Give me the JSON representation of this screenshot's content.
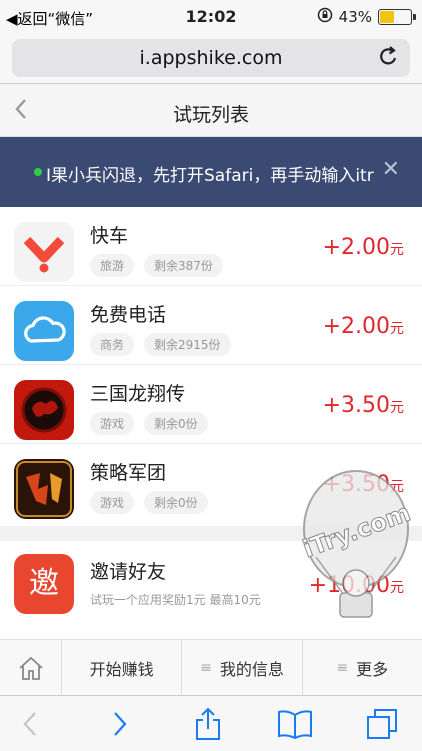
{
  "status": {
    "back_label": "◀返回“微信”",
    "time": "12:02",
    "battery": "43%",
    "battery_level": 0.43
  },
  "browser": {
    "url": "i.appshike.com"
  },
  "header": {
    "title": "试玩列表"
  },
  "notice": {
    "text": "I果小兵闪退，先打开Safari，再手动输入itr"
  },
  "tasks": [
    {
      "name": "快车",
      "tags": [
        "旅游",
        "剩余387份"
      ],
      "amount": "+2.00",
      "unit": "元",
      "icon": "kuaiche-app-icon"
    },
    {
      "name": "免费电话",
      "tags": [
        "商务",
        "剩余2915份"
      ],
      "amount": "+2.00",
      "unit": "元",
      "icon": "cloud-phone-app-icon"
    },
    {
      "name": "三国龙翔传",
      "tags": [
        "游戏",
        "剩余0份"
      ],
      "amount": "+3.50",
      "unit": "元",
      "icon": "sanguo-game-app-icon"
    },
    {
      "name": "策略军团",
      "tags": [
        "游戏",
        "剩余0份"
      ],
      "amount": "+3.50",
      "unit": "元",
      "icon": "strategy-game-app-icon"
    }
  ],
  "invite": {
    "icon_char": "邀",
    "name": "邀请好友",
    "desc": "试玩一个应用奖励1元 最高10元",
    "amount": "+10.00",
    "unit": "元"
  },
  "app_tabs": {
    "start": "开始赚钱",
    "info": "我的信息",
    "more": "更多"
  },
  "watermark": {
    "text": "iTry.com"
  },
  "colors": {
    "accent": "#e2262b",
    "notice_bg": "#3a4a72",
    "link_blue": "#1a7cf5"
  }
}
